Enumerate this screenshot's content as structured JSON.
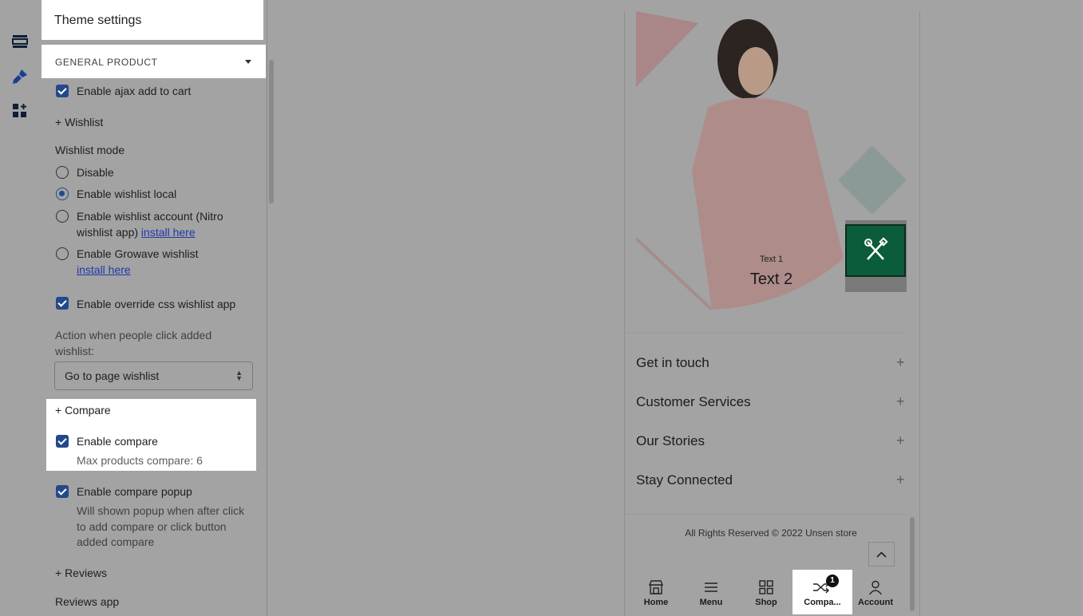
{
  "rail": {
    "icons": [
      "sections-icon",
      "theme-brush-icon",
      "apps-icon"
    ]
  },
  "panel": {
    "title": "Theme settings",
    "section": "GENERAL PRODUCT",
    "ajax": "Enable ajax add to cart",
    "wishlist_heading": "+ Wishlist",
    "wishlist_mode_label": "Wishlist mode",
    "radios": [
      {
        "label": "Disable",
        "selected": false
      },
      {
        "label": "Enable wishlist local",
        "selected": true
      },
      {
        "label": "Enable wishlist account (Nitro",
        "label2": "wishlist app)",
        "link": "install here",
        "selected": false
      },
      {
        "label": "Enable Growave wishlist",
        "link": "install here",
        "selected": false
      }
    ],
    "override_css": "Enable override css wishlist app",
    "action_label": "Action when people click added",
    "action_label2": "wishlist:",
    "action_select": "Go to page wishlist",
    "compare_heading": "+ Compare",
    "enable_compare": "Enable compare",
    "max_compare": "Max products compare: 6",
    "compare_popup": "Enable compare popup",
    "popup_help1": "Will shown popup when after click",
    "popup_help2": "to add compare or click button",
    "popup_help3": "added compare",
    "reviews_heading": "+ Reviews",
    "reviews_app": "Reviews app"
  },
  "preview": {
    "hero_text1": "Text 1",
    "hero_text2": "Text 2",
    "accordion": [
      "Get in touch",
      "Customer Services",
      "Our Stories",
      "Stay Connected"
    ],
    "footer": "All Rights Reserved © 2022 Unsen store",
    "nav": [
      {
        "label": "Home",
        "icon": "store-icon"
      },
      {
        "label": "Menu",
        "icon": "menu-icon"
      },
      {
        "label": "Shop",
        "icon": "grid-icon"
      },
      {
        "label": "Compa...",
        "icon": "shuffle-icon",
        "badge": "1"
      },
      {
        "label": "Account",
        "icon": "user-icon"
      }
    ]
  },
  "colors": {
    "accent": "#24498a",
    "tool_button": "#0b5c3a",
    "overlay": "#a3a3a3"
  }
}
